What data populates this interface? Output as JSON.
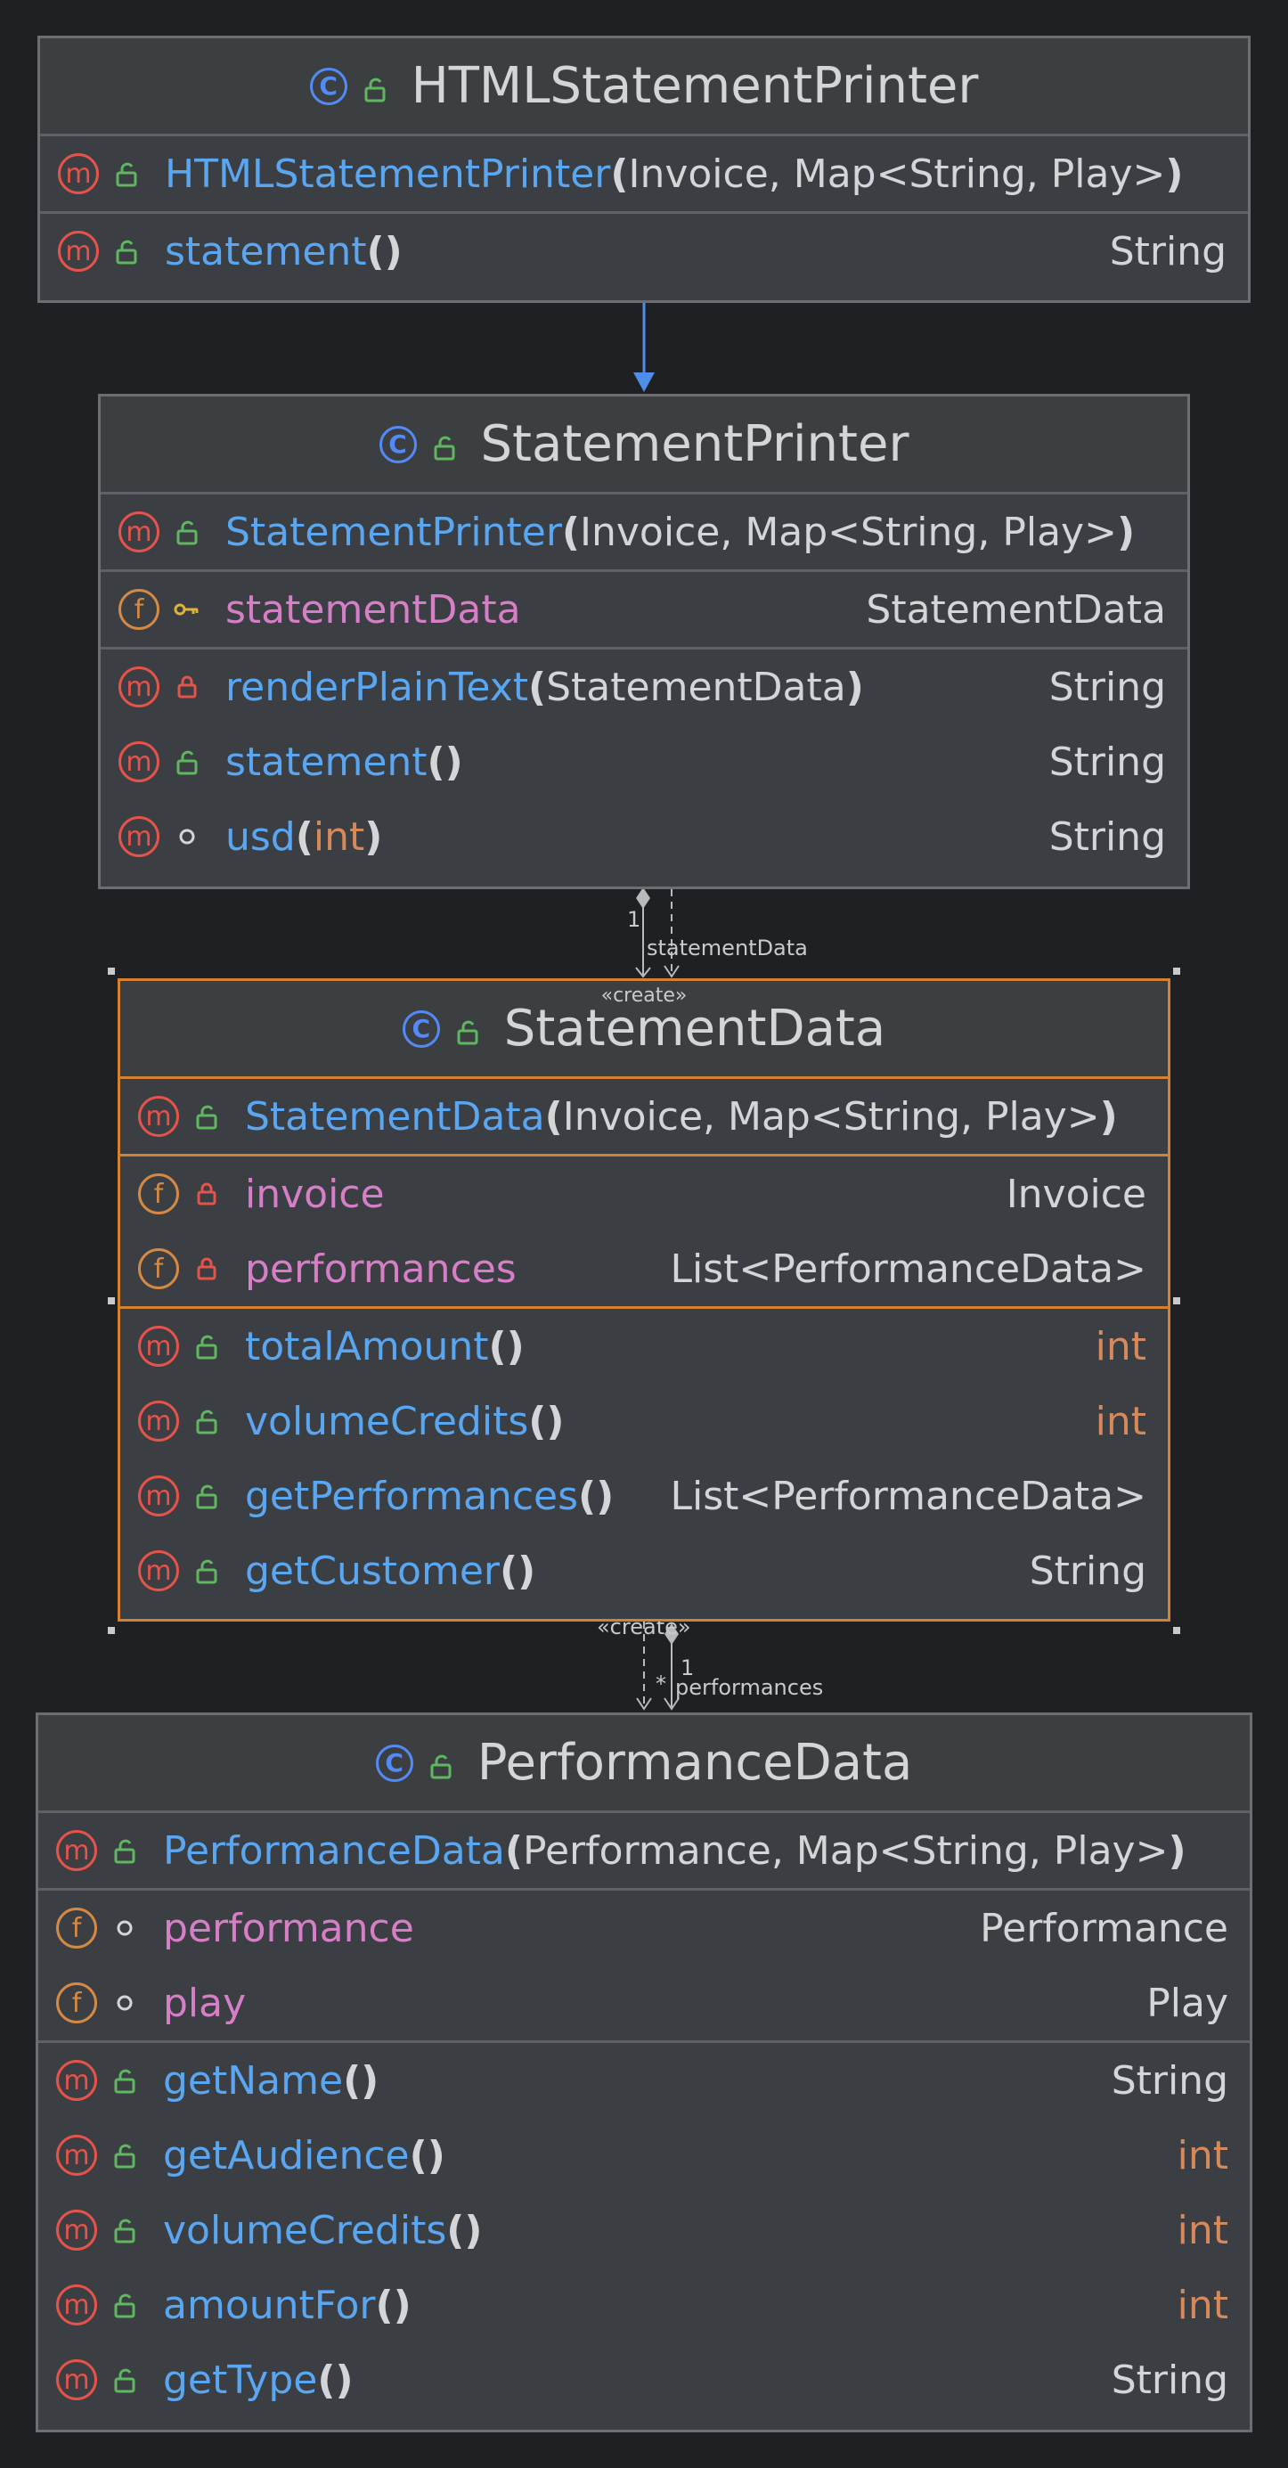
{
  "classes": {
    "html_printer": {
      "name": "HTMLStatementPrinter",
      "ctor": {
        "name": "HTMLStatementPrinter",
        "params": "Invoice, Map<String, Play>"
      },
      "methods": [
        {
          "name": "statement",
          "type": "String"
        }
      ]
    },
    "statement_printer": {
      "name": "StatementPrinter",
      "ctor": {
        "name": "StatementPrinter",
        "params": "Invoice, Map<String, Play>"
      },
      "fields": [
        {
          "name": "statementData",
          "type": "StatementData"
        }
      ],
      "methods": [
        {
          "name": "renderPlainText",
          "params": "StatementData",
          "type": "String"
        },
        {
          "name": "statement",
          "type": "String"
        },
        {
          "name": "usd",
          "params": "int",
          "type": "String"
        }
      ]
    },
    "statement_data": {
      "name": "StatementData",
      "stereotype": "«create»",
      "ctor": {
        "name": "StatementData",
        "params": "Invoice, Map<String, Play>"
      },
      "fields": [
        {
          "name": "invoice",
          "type": "Invoice"
        },
        {
          "name": "performances",
          "type": "List<PerformanceData>"
        }
      ],
      "methods": [
        {
          "name": "totalAmount",
          "type": "int"
        },
        {
          "name": "volumeCredits",
          "type": "int"
        },
        {
          "name": "getPerformances",
          "type": "List<PerformanceData>"
        },
        {
          "name": "getCustomer",
          "type": "String"
        }
      ]
    },
    "performance_data": {
      "name": "PerformanceData",
      "ctor": {
        "name": "PerformanceData",
        "params": "Performance, Map<String, Play>"
      },
      "fields": [
        {
          "name": "performance",
          "type": "Performance"
        },
        {
          "name": "play",
          "type": "Play"
        }
      ],
      "methods": [
        {
          "name": "getName",
          "type": "String"
        },
        {
          "name": "getAudience",
          "type": "int"
        },
        {
          "name": "volumeCredits",
          "type": "int"
        },
        {
          "name": "amountFor",
          "type": "int"
        },
        {
          "name": "getType",
          "type": "String"
        }
      ]
    }
  },
  "edges": {
    "sp_sd_multiplicity": "1",
    "sp_sd_role": "statementData",
    "sd_pd_stereotype": "«create»",
    "sd_pd_multiplicity_src": "1",
    "sd_pd_multiplicity_dst": "*",
    "sd_pd_role": "performances"
  },
  "icons": {
    "class_badge": "C",
    "method_badge": "m",
    "field_badge": "f",
    "paren_open": "(",
    "paren_close": ")",
    "paren_pair": "()"
  },
  "colors": {
    "background": "#1f2024",
    "box": "#3b3e42",
    "border": "#6c6e72",
    "selected_border": "#d5822f",
    "method_name": "#5ba6f0",
    "field_name": "#d67fc6",
    "primitive_type": "#d6895a",
    "arrow_blue": "#4e8ee8"
  }
}
